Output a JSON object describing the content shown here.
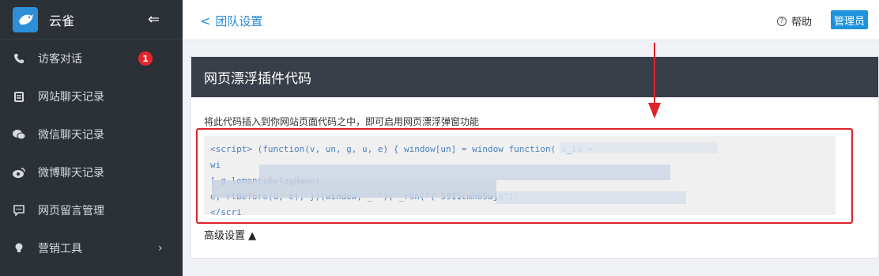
{
  "sidebar": {
    "brand": "云雀",
    "collapse_icon": "⇐",
    "items": [
      {
        "label": "访客对话",
        "icon": "phone-icon",
        "badge": "1"
      },
      {
        "label": "网站聊天记录",
        "icon": "calendar-icon"
      },
      {
        "label": "微信聊天记录",
        "icon": "wechat-icon"
      },
      {
        "label": "微博聊天记录",
        "icon": "weibo-icon"
      },
      {
        "label": "网页留言管理",
        "icon": "message-icon"
      },
      {
        "label": "营销工具",
        "icon": "bulb-icon",
        "chevron": "›"
      }
    ]
  },
  "topbar": {
    "back_label": "团队设置",
    "help_label": "帮助",
    "role_label": "管理员"
  },
  "panel": {
    "title": "网页漂浮插件代码",
    "description": "将此代码插入到你网站页面代码之中，即可启用网页漂浮弹窗功能",
    "code_lines": [
      "<script> (function(v, un, g, u, e) { window[un] = window        function(                         v_id =",
      "wi",
      "[        g                               lementsByTagName(",
      "e,           rtBefore(u, e); })(window, _                                          \"); _rsn(\"( 5911cmh65ajo\");",
      "</scri"
    ],
    "advanced_label": "高级设置 ▲"
  },
  "colors": {
    "sidebar_bg": "#2c3138",
    "accent": "#1c93dc",
    "badge": "#e6262e",
    "panel_header": "#393f49",
    "annotation": "#e0222b"
  }
}
